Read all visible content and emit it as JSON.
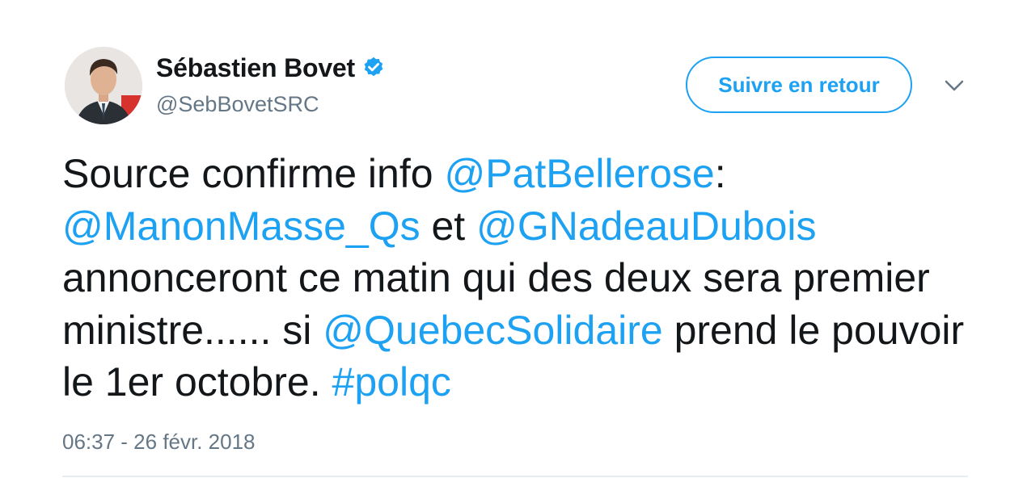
{
  "author": {
    "display_name": "Sébastien Bovet",
    "handle": "@SebBovetSRC",
    "verified": true,
    "avatar_icon": "profile-photo"
  },
  "actions": {
    "follow_label": "Suivre en retour",
    "menu_icon": "chevron-down-icon"
  },
  "tweet": {
    "segments": [
      {
        "text": "Source confirme info ",
        "type": "text"
      },
      {
        "text": "@PatBellerose",
        "type": "mention"
      },
      {
        "text": ": ",
        "type": "text"
      },
      {
        "text": "@ManonMasse_Qs",
        "type": "mention"
      },
      {
        "text": " et ",
        "type": "text"
      },
      {
        "text": "@GNadeauDubois",
        "type": "mention"
      },
      {
        "text": " annonceront ce matin qui des deux sera premier ministre...... si ",
        "type": "text"
      },
      {
        "text": "@QuebecSolidaire",
        "type": "mention"
      },
      {
        "text": " prend le pouvoir le 1er octobre. ",
        "type": "text"
      },
      {
        "text": "#polqc",
        "type": "hashtag"
      }
    ],
    "timestamp": "06:37 - 26 févr. 2018"
  },
  "colors": {
    "link": "#1da1f2",
    "text": "#14171a",
    "secondary": "#657786",
    "divider": "#e6ecf0"
  }
}
